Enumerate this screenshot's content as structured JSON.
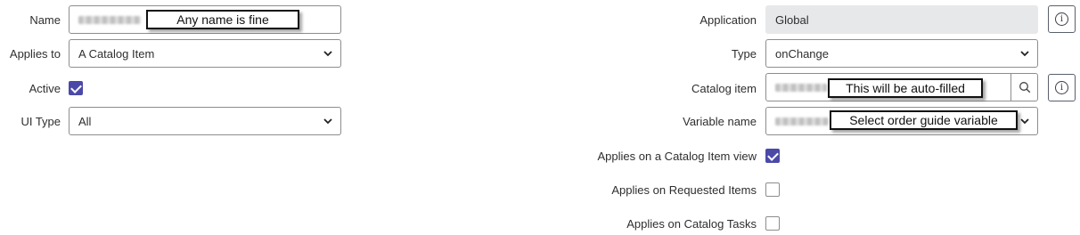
{
  "left": {
    "name": {
      "label": "Name",
      "callout": "Any name is fine"
    },
    "applies_to": {
      "label": "Applies to",
      "value": "A Catalog Item"
    },
    "active": {
      "label": "Active",
      "checked": true
    },
    "ui_type": {
      "label": "UI Type",
      "value": "All"
    }
  },
  "right": {
    "application": {
      "label": "Application",
      "value": "Global"
    },
    "type": {
      "label": "Type",
      "value": "onChange"
    },
    "catalog_item": {
      "label": "Catalog item",
      "callout": "This will be auto-filled"
    },
    "variable_name": {
      "label": "Variable name",
      "callout": "Select order guide variable"
    },
    "applies_catalog_view": {
      "label": "Applies on a Catalog Item view",
      "checked": true
    },
    "applies_requested_items": {
      "label": "Applies on Requested Items",
      "checked": false
    },
    "applies_catalog_tasks": {
      "label": "Applies on Catalog Tasks",
      "checked": false
    }
  },
  "icons": {
    "info": "info-icon",
    "search": "search-icon",
    "chevron": "chevron-down-icon",
    "checkmark": "checkmark-icon"
  },
  "colors": {
    "accent_checkbox": "#4b49a8",
    "readonly_bg": "#e6e8ea",
    "border": "#8d8d8d"
  }
}
